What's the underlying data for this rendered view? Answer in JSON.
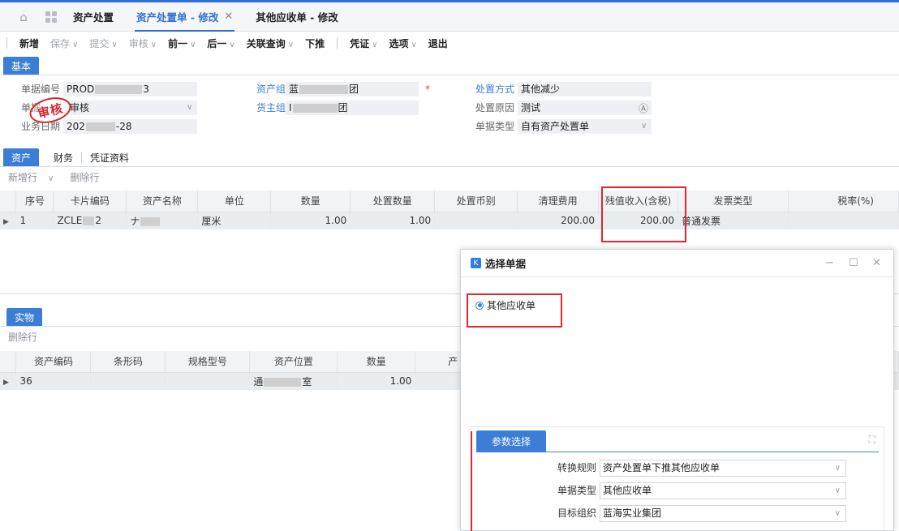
{
  "tabs": {
    "home_icon": "home-icon",
    "apps_icon": "grid-icon",
    "items": [
      {
        "label": "资产处置"
      },
      {
        "label": "资产处置单 - 修改",
        "active": true
      },
      {
        "label": "其他应收单 - 修改"
      }
    ],
    "close_glyph": "✕"
  },
  "toolbar": {
    "new": "新增",
    "save": "保存",
    "submit": "提交",
    "audit": "审核",
    "prev": "前一",
    "next": "后一",
    "related": "关联查询",
    "push": "下推",
    "voucher": "凭证",
    "options": "选项",
    "exit": "退出"
  },
  "basic": {
    "tab": "基本",
    "doc_no_label": "单据编号",
    "doc_no_prefix": "PROD",
    "doc_no_suffix": "3",
    "status_label": "单据",
    "status_value": "审核",
    "stamp": "审核",
    "date_label": "业务日期",
    "date_prefix": "202",
    "date_suffix": "-28",
    "asset_org_label": "资产组织",
    "asset_org_prefix": "蓝",
    "asset_org_suffix": "团",
    "owner_org_label": "货主组织",
    "owner_org_prefix": "I",
    "owner_org_suffix": "团",
    "required_mark": "*",
    "method_label": "处置方式",
    "method_value": "其他减少",
    "reason_label": "处置原因",
    "reason_value": "测试",
    "reason_icon": "Ⓐ",
    "type_label": "单据类型",
    "type_value": "自有资产处置单"
  },
  "asset_tabs": {
    "items": [
      "资产",
      "财务",
      "凭证资料"
    ]
  },
  "asset_toolbar": {
    "add_row": "新增行",
    "delete_row": "删除行"
  },
  "asset_table": {
    "columns": [
      "序号",
      "卡片编码",
      "资产名称",
      "单位",
      "数量",
      "处置数量",
      "处置币别",
      "清理费用",
      "残值收入(含税)",
      "发票类型",
      "税率(%)"
    ],
    "rows": [
      {
        "seq": "1",
        "card": "ZCLE",
        "card_suffix": "2",
        "name": "ナ",
        "unit": "厘米",
        "qty": "1.00",
        "dispose_qty": "1.00",
        "currency": "",
        "fee": "200.00",
        "residual": "200.00",
        "invoice": "普通发票",
        "tax": ""
      }
    ]
  },
  "physical": {
    "tab": "实物",
    "delete_row": "删除行",
    "columns": [
      "资产编码",
      "条形码",
      "规格型号",
      "资产位置",
      "数量",
      "产"
    ],
    "rows": [
      {
        "code": "36",
        "barcode": "",
        "spec": "",
        "location_prefix": "通",
        "location_suffix": "室",
        "qty": "1.00"
      }
    ]
  },
  "dialog": {
    "title": "选择单据",
    "logo": "K",
    "minimize": "−",
    "maximize": "☐",
    "close": "✕",
    "radio_label": "其他应收单",
    "param_tab": "参数选择",
    "expand_glyph": "⛶",
    "rule_label": "转换规则",
    "rule_value": "资产处置单下推其他应收单",
    "type_label": "单据类型",
    "type_value": "其他应收单",
    "org_label": "目标组织",
    "org_value": "蓝海实业集团"
  },
  "colors": {
    "accent": "#3c7ed6",
    "highlight_box": "#e4252c",
    "stamp": "#d5262d"
  }
}
